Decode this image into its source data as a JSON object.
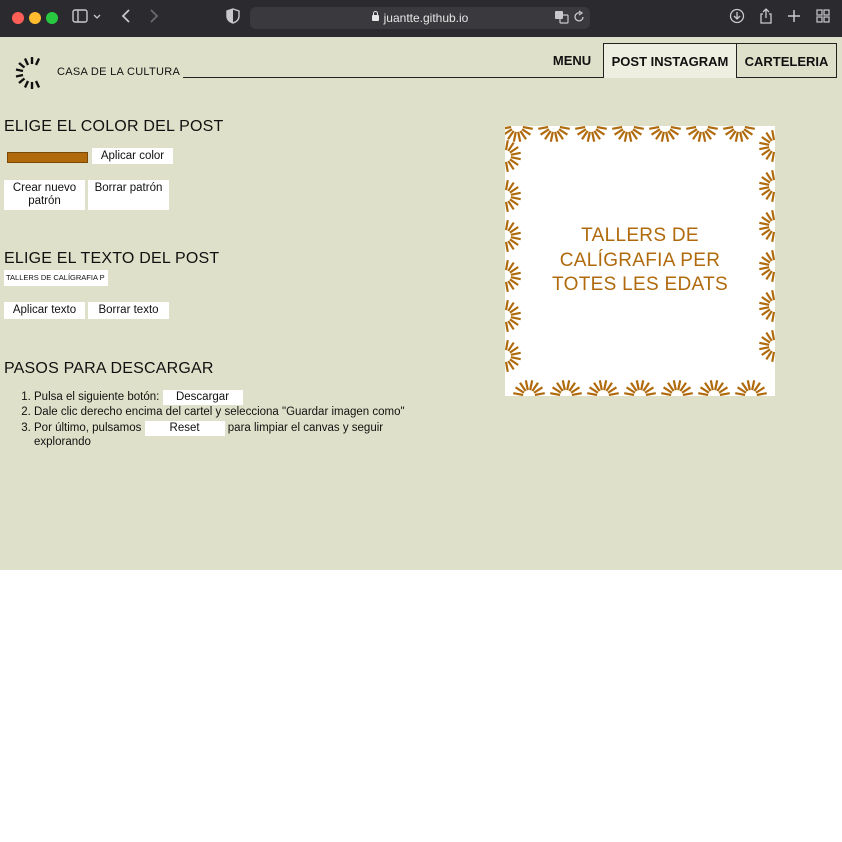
{
  "browser": {
    "url": "juantte.github.io"
  },
  "brand": {
    "name": "CASA DE LA CULTURA"
  },
  "nav": {
    "menu": "MENU",
    "instagram": "POST INSTAGRAM",
    "carteleria": "CARTELERIA"
  },
  "color_section": {
    "heading": "ELIGE EL COLOR DEL POST",
    "swatch_color": "#b06a0c",
    "apply_label": "Aplicar color",
    "new_pattern_label": "Crear nuevo patrón",
    "delete_pattern_label": "Borrar patrón"
  },
  "text_section": {
    "heading": "ELIGE EL TEXTO DEL POST",
    "input_value": "TALLERS DE CALÍGRAFIA P",
    "apply_label": "Aplicar texto",
    "delete_label": "Borrar texto"
  },
  "download_section": {
    "heading": "PASOS PARA DESCARGAR",
    "step1": "Pulsa el siguiente botón:",
    "download_label": "Descargar",
    "step2": "Dale clic derecho encima del cartel y selecciona \"Guardar imagen como\"",
    "step3_pre": "Por último, pulsamos",
    "reset_label": "Reset",
    "step3_post": "para limpiar el canvas y seguir explorando"
  },
  "poster": {
    "line1": "TALLERS DE",
    "line2": "CALÍGRAFIA PER",
    "line3": "TOTES LES EDATS",
    "accent": "#b06a0c"
  }
}
